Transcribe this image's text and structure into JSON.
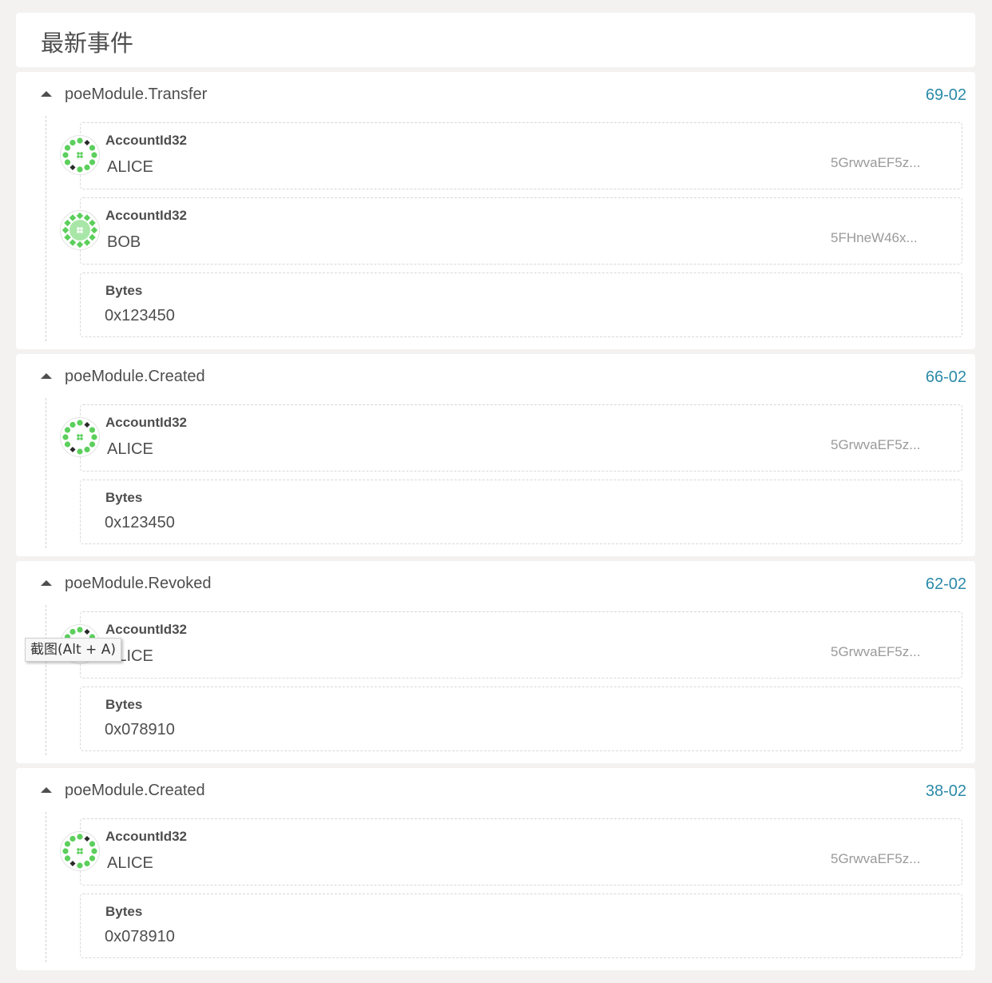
{
  "header": {
    "title": "最新事件"
  },
  "events": [
    {
      "title": "poeModule.Transfer",
      "time": "69-02",
      "params": [
        {
          "label": "AccountId32",
          "value": "ALICE",
          "address": "5GrwvaEF5z..."
        },
        {
          "label": "AccountId32",
          "value": "BOB",
          "address": "5FHneW46x..."
        },
        {
          "label": "Bytes",
          "value": "0x123450"
        }
      ]
    },
    {
      "title": "poeModule.Created",
      "time": "66-02",
      "params": [
        {
          "label": "AccountId32",
          "value": "ALICE",
          "address": "5GrwvaEF5z..."
        },
        {
          "label": "Bytes",
          "value": "0x123450"
        }
      ]
    },
    {
      "title": "poeModule.Revoked",
      "time": "62-02",
      "params": [
        {
          "label": "AccountId32",
          "value": "ALICE",
          "address": "5GrwvaEF5z..."
        },
        {
          "label": "Bytes",
          "value": "0x078910"
        }
      ]
    },
    {
      "title": "poeModule.Created",
      "time": "38-02",
      "params": [
        {
          "label": "AccountId32",
          "value": "ALICE",
          "address": "5GrwvaEF5z..."
        },
        {
          "label": "Bytes",
          "value": "0x078910"
        }
      ]
    }
  ],
  "tooltip": {
    "text": "截图(Alt + A)"
  },
  "icons": {
    "collapse": "caret-up-icon",
    "identicon": "identicon-icon"
  },
  "colors": {
    "accent": "#2b8aa8",
    "identicon_green": "#5ccf5c",
    "identicon_light": "#a8e6a8",
    "background": "#f3f2f1"
  }
}
